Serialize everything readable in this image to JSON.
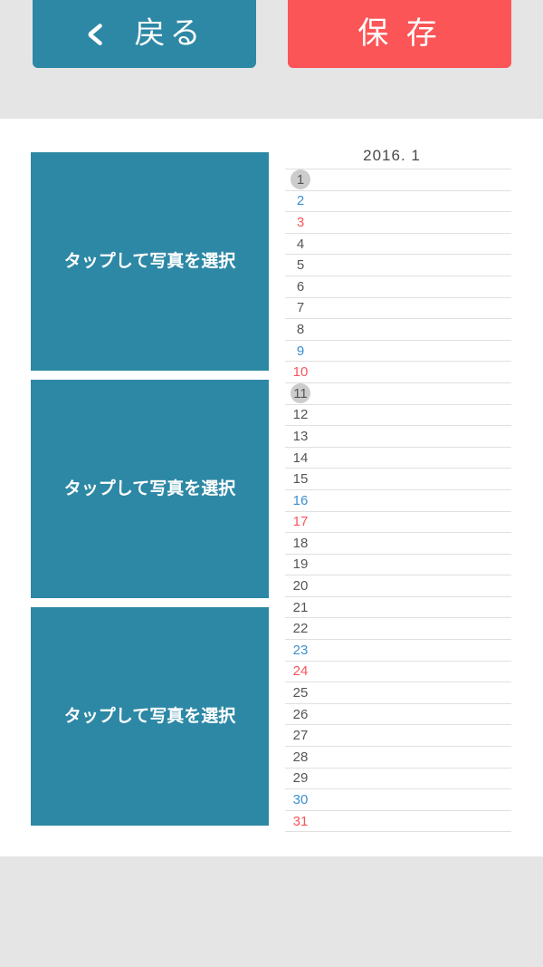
{
  "toolbar": {
    "back_button": {
      "label": "戻る",
      "icon": "chevron-left-icon",
      "color": "#2d88a5"
    },
    "save_button": {
      "label": "保 存",
      "color": "#fb5557"
    }
  },
  "photos": {
    "placeholder_label": "タップして写真を選択",
    "tiles": [
      {
        "label": "タップして写真を選択"
      },
      {
        "label": "タップして写真を選択"
      },
      {
        "label": "タップして写真を選択"
      }
    ],
    "tile_color": "#2d88a5"
  },
  "calendar": {
    "title": "2016. 1",
    "year": 2016,
    "month": 1,
    "colors": {
      "weekday": "#555555",
      "saturday": "#3b8fd0",
      "sunday": "#f9545a",
      "marker": "#cccccc"
    },
    "days": [
      {
        "day": "1",
        "type": "weekday",
        "marked": true
      },
      {
        "day": "2",
        "type": "sat",
        "marked": false
      },
      {
        "day": "3",
        "type": "sun",
        "marked": false
      },
      {
        "day": "4",
        "type": "weekday",
        "marked": false
      },
      {
        "day": "5",
        "type": "weekday",
        "marked": false
      },
      {
        "day": "6",
        "type": "weekday",
        "marked": false
      },
      {
        "day": "7",
        "type": "weekday",
        "marked": false
      },
      {
        "day": "8",
        "type": "weekday",
        "marked": false
      },
      {
        "day": "9",
        "type": "sat",
        "marked": false
      },
      {
        "day": "10",
        "type": "sun",
        "marked": false
      },
      {
        "day": "11",
        "type": "weekday",
        "marked": true
      },
      {
        "day": "12",
        "type": "weekday",
        "marked": false
      },
      {
        "day": "13",
        "type": "weekday",
        "marked": false
      },
      {
        "day": "14",
        "type": "weekday",
        "marked": false
      },
      {
        "day": "15",
        "type": "weekday",
        "marked": false
      },
      {
        "day": "16",
        "type": "sat",
        "marked": false
      },
      {
        "day": "17",
        "type": "sun",
        "marked": false
      },
      {
        "day": "18",
        "type": "weekday",
        "marked": false
      },
      {
        "day": "19",
        "type": "weekday",
        "marked": false
      },
      {
        "day": "20",
        "type": "weekday",
        "marked": false
      },
      {
        "day": "21",
        "type": "weekday",
        "marked": false
      },
      {
        "day": "22",
        "type": "weekday",
        "marked": false
      },
      {
        "day": "23",
        "type": "sat",
        "marked": false
      },
      {
        "day": "24",
        "type": "sun",
        "marked": false
      },
      {
        "day": "25",
        "type": "weekday",
        "marked": false
      },
      {
        "day": "26",
        "type": "weekday",
        "marked": false
      },
      {
        "day": "27",
        "type": "weekday",
        "marked": false
      },
      {
        "day": "28",
        "type": "weekday",
        "marked": false
      },
      {
        "day": "29",
        "type": "weekday",
        "marked": false
      },
      {
        "day": "30",
        "type": "sat",
        "marked": false
      },
      {
        "day": "31",
        "type": "sun",
        "marked": false
      }
    ]
  }
}
